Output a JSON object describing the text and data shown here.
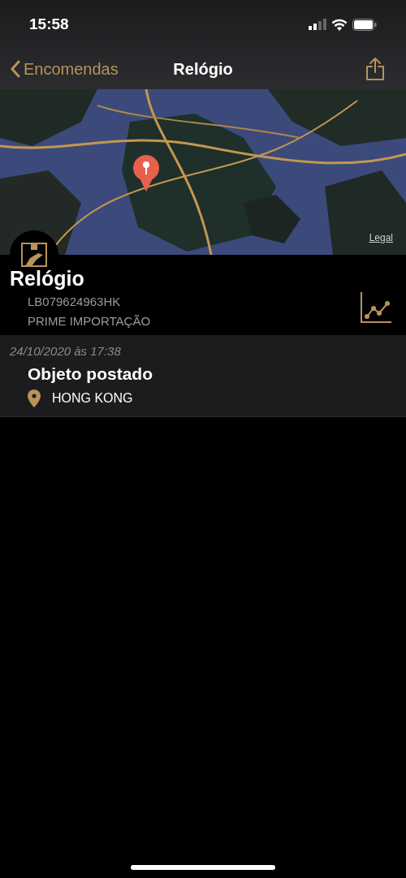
{
  "status_bar": {
    "time": "15:58"
  },
  "nav": {
    "back": "Encomendas",
    "title": "Relógio"
  },
  "map": {
    "legal": "Legal"
  },
  "package": {
    "name": "Relógio",
    "code": "LB079624963HK",
    "category": "PRIME IMPORTAÇÃO"
  },
  "events": [
    {
      "date": "24/10/2020 às 17:38",
      "title": "Objeto postado",
      "location": "HONG KONG"
    }
  ]
}
